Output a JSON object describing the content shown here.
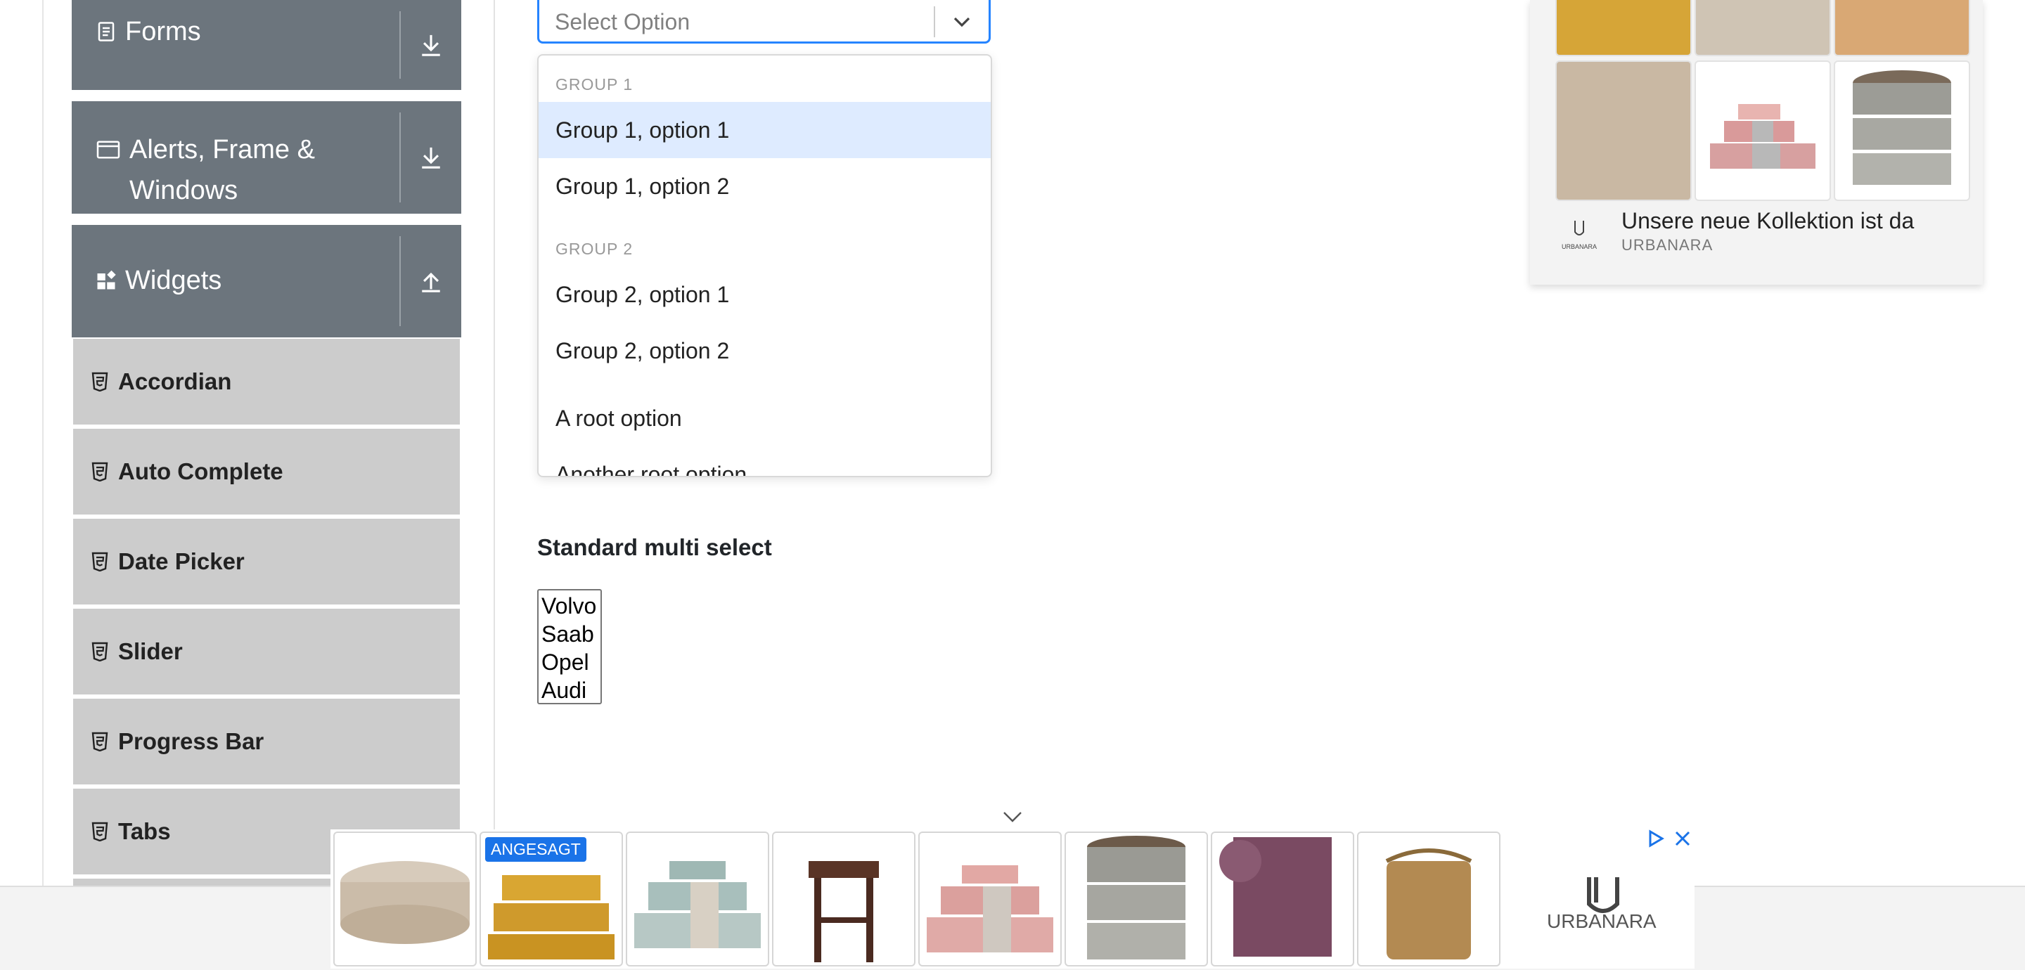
{
  "sidebar": {
    "groups": [
      {
        "label": "Forms",
        "icon": "form-icon",
        "toggle": "download-arrow-icon"
      },
      {
        "label": "Alerts, Frame &",
        "label2": "Windows",
        "icon": "window-icon",
        "toggle": "download-arrow-icon"
      },
      {
        "label": "Widgets",
        "icon": "widgets-icon",
        "toggle": "upload-arrow-icon"
      }
    ],
    "items": [
      {
        "label": "Accordian"
      },
      {
        "label": "Auto Complete"
      },
      {
        "label": "Date Picker"
      },
      {
        "label": "Slider"
      },
      {
        "label": "Progress Bar"
      },
      {
        "label": "Tabs"
      }
    ]
  },
  "select": {
    "placeholder": "Select Option",
    "menu": {
      "groups": [
        {
          "heading": "GROUP 1",
          "options": [
            "Group 1, option 1",
            "Group 1, option 2"
          ]
        },
        {
          "heading": "GROUP 2",
          "options": [
            "Group 2, option 1",
            "Group 2, option 2"
          ]
        }
      ],
      "root_options": [
        "A root option",
        "Another root option"
      ],
      "focused": "Group 1, option 1"
    }
  },
  "multi_select": {
    "title": "Standard multi select",
    "options": [
      "Volvo",
      "Saab",
      "Opel",
      "Audi"
    ]
  },
  "ad_top": {
    "caption": "Unsere neue Kollektion ist da",
    "brand": "URBANARA"
  },
  "ad_bottom": {
    "badge": "ANGESAGT",
    "brand": "URBANARA"
  },
  "colors": {
    "sidebar_header": "#6c757d",
    "sidebar_item": "#cccccc",
    "select_focus": "#2684ff",
    "option_focus": "#deebff",
    "ad_badge": "#1a73e8"
  }
}
